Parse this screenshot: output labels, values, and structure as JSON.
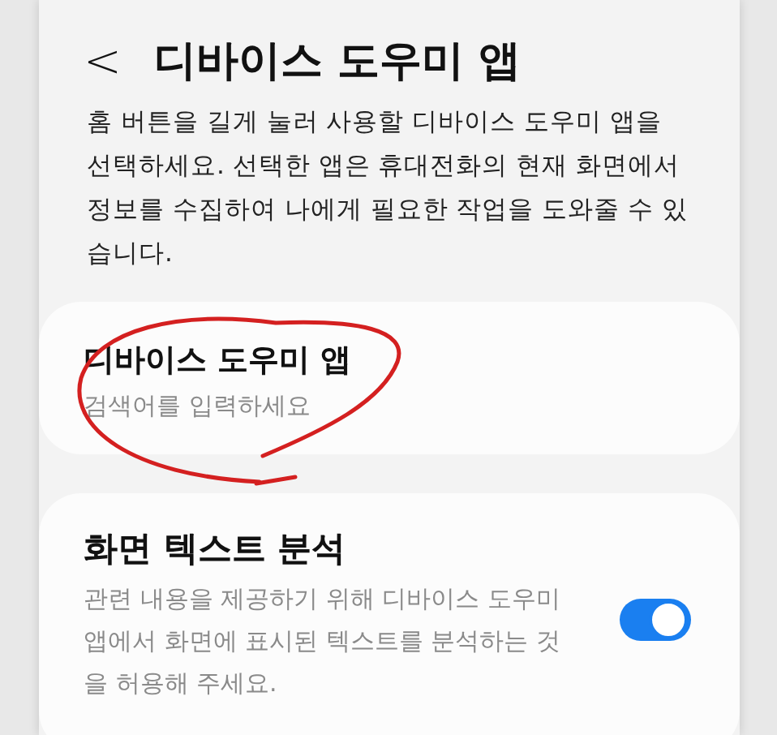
{
  "header": {
    "back": "<",
    "title": "디바이스 도우미 앱"
  },
  "description": "홈 버튼을 길게 눌러 사용할 디바이스 도우미 앱을 선택하세요. 선택한 앱은 휴대전화의 현재 화면에서 정보를 수집하여 나에게 필요한 작업을 도와줄 수 있습니다.",
  "settings": [
    {
      "kind": "link",
      "title": "디바이스 도우미 앱",
      "summary": "검색어를 입력하세요"
    },
    {
      "kind": "switch",
      "title": "화면 텍스트 분석",
      "summary": "관련 내용을 제공하기 위해 디바이스 도우미 앱에서 화면에 표시된 텍스트를 분석하는 것을 허용해 주세요.",
      "on": true
    }
  ]
}
